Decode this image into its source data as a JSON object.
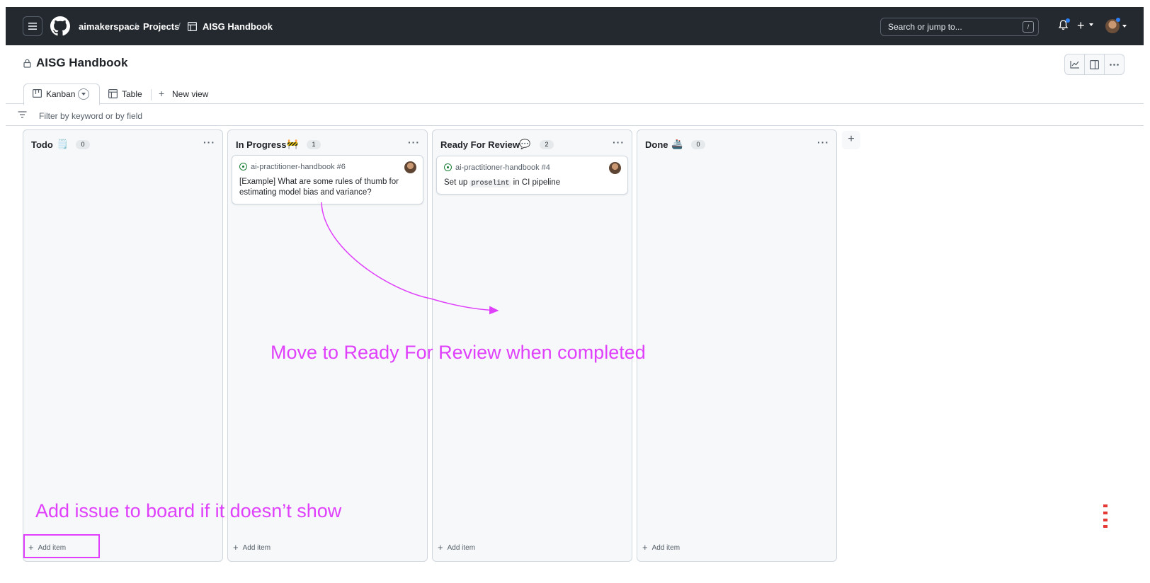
{
  "nav": {
    "org": "aimakerspace",
    "projects": "Projects",
    "project": "AISG Handbook",
    "separator": "/",
    "search_placeholder": "Search or jump to...",
    "search_shortcut": "/"
  },
  "header": {
    "title": "AISG Handbook"
  },
  "tabs": {
    "kanban": "Kanban",
    "table": "Table",
    "new_view": "New view"
  },
  "filter": {
    "placeholder": "Filter by keyword or by field"
  },
  "columns": [
    {
      "title": "Todo",
      "emoji": "🗒️",
      "count": "0",
      "add_label": "Add item",
      "cards": []
    },
    {
      "title": "In Progress",
      "emoji": "🚧",
      "count": "1",
      "add_label": "Add item",
      "cards": [
        {
          "ref": "ai-practitioner-handbook #6",
          "title": "[Example] What are some rules of thumb for estimating model bias and variance?"
        }
      ]
    },
    {
      "title": "Ready For Review",
      "emoji": "💬",
      "count": "2",
      "add_label": "Add item",
      "cards": [
        {
          "ref": "ai-practitioner-handbook #4",
          "title_pre": "Set up ",
          "title_code": "proselint",
          "title_post": " in CI pipeline"
        }
      ]
    },
    {
      "title": "Done",
      "emoji": "🚢",
      "count": "0",
      "add_label": "Add item",
      "cards": []
    }
  ],
  "annotations": {
    "move": "Move to Ready For Review when completed",
    "add": "Add issue to board if it doesn’t show",
    "color": "#e040fb"
  },
  "icons": {
    "menu": "hamburger-icon",
    "logo": "github-logo",
    "table": "table-icon",
    "lock": "lock-icon",
    "bell": "bell-icon",
    "plus": "plus-icon",
    "insights": "graph-icon",
    "panel": "sidebar-panel-icon",
    "more": "kebab-icon",
    "filter": "filter-icon",
    "issue_open": "issue-opened-icon"
  }
}
